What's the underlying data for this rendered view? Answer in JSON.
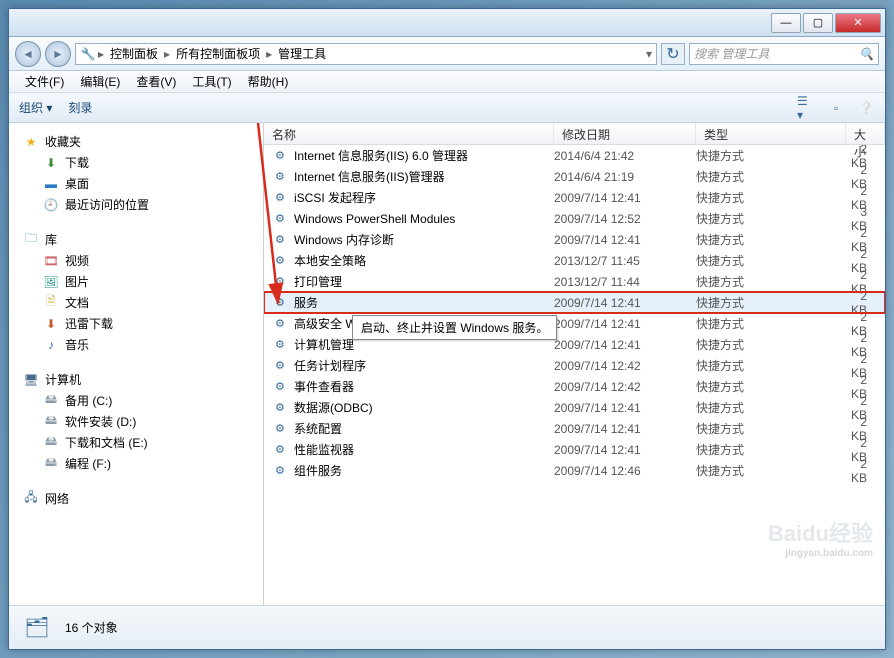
{
  "breadcrumb": [
    "控制面板",
    "所有控制面板项",
    "管理工具"
  ],
  "search_placeholder": "搜索 管理工具",
  "menu": {
    "file": "文件(F)",
    "edit": "编辑(E)",
    "view": "查看(V)",
    "tools": "工具(T)",
    "help": "帮助(H)"
  },
  "toolbar": {
    "organize": "组织 ▾",
    "burn": "刻录"
  },
  "columns": {
    "name": "名称",
    "date": "修改日期",
    "type": "类型",
    "size": "大小"
  },
  "sidebar": {
    "favorites": {
      "label": "收藏夹",
      "items": [
        "下载",
        "桌面",
        "最近访问的位置"
      ]
    },
    "libraries": {
      "label": "库",
      "items": [
        "视频",
        "图片",
        "文档",
        "迅雷下载",
        "音乐"
      ]
    },
    "computer": {
      "label": "计算机",
      "items": [
        "备用 (C:)",
        "软件安装 (D:)",
        "下载和文档 (E:)",
        "编程 (F:)"
      ]
    },
    "network": {
      "label": "网络"
    }
  },
  "rows": [
    {
      "name": "Internet 信息服务(IIS) 6.0 管理器",
      "date": "2014/6/4 21:42",
      "type": "快捷方式",
      "size": "2 KB"
    },
    {
      "name": "Internet 信息服务(IIS)管理器",
      "date": "2014/6/4 21:19",
      "type": "快捷方式",
      "size": "2 KB"
    },
    {
      "name": "iSCSI 发起程序",
      "date": "2009/7/14 12:41",
      "type": "快捷方式",
      "size": "2 KB"
    },
    {
      "name": "Windows PowerShell Modules",
      "date": "2009/7/14 12:52",
      "type": "快捷方式",
      "size": "3 KB"
    },
    {
      "name": "Windows 内存诊断",
      "date": "2009/7/14 12:41",
      "type": "快捷方式",
      "size": "2 KB"
    },
    {
      "name": "本地安全策略",
      "date": "2013/12/7 11:45",
      "type": "快捷方式",
      "size": "2 KB"
    },
    {
      "name": "打印管理",
      "date": "2013/12/7 11:44",
      "type": "快捷方式",
      "size": "2 KB"
    },
    {
      "name": "服务",
      "date": "2009/7/14 12:41",
      "type": "快捷方式",
      "size": "2 KB",
      "selected": true
    },
    {
      "name": "高级安全 W",
      "date": "2009/7/14 12:41",
      "type": "快捷方式",
      "size": "2 KB"
    },
    {
      "name": "计算机管理",
      "date": "2009/7/14 12:41",
      "type": "快捷方式",
      "size": "2 KB"
    },
    {
      "name": "任务计划程序",
      "date": "2009/7/14 12:42",
      "type": "快捷方式",
      "size": "2 KB"
    },
    {
      "name": "事件查看器",
      "date": "2009/7/14 12:42",
      "type": "快捷方式",
      "size": "2 KB"
    },
    {
      "name": "数据源(ODBC)",
      "date": "2009/7/14 12:41",
      "type": "快捷方式",
      "size": "2 KB"
    },
    {
      "name": "系统配置",
      "date": "2009/7/14 12:41",
      "type": "快捷方式",
      "size": "2 KB"
    },
    {
      "name": "性能监视器",
      "date": "2009/7/14 12:41",
      "type": "快捷方式",
      "size": "2 KB"
    },
    {
      "name": "组件服务",
      "date": "2009/7/14 12:46",
      "type": "快捷方式",
      "size": "2 KB"
    }
  ],
  "tooltip": "启动、终止并设置 Windows 服务。",
  "status": {
    "count": "16 个对象"
  },
  "watermark": {
    "brand": "Baidu经验",
    "sub": "jingyan.baidu.com"
  }
}
